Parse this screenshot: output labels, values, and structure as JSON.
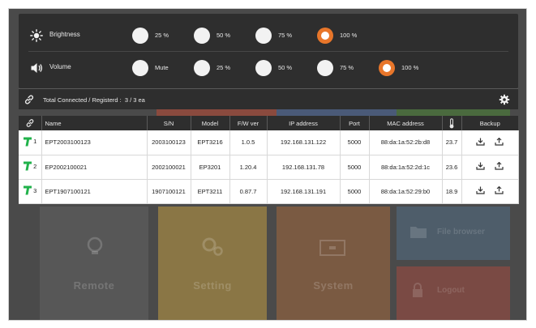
{
  "controls": {
    "brightness": {
      "label": "Brightness",
      "options": [
        "25 %",
        "50 %",
        "75 %",
        "100 %"
      ],
      "selected": "100 %"
    },
    "volume": {
      "label": "Volume",
      "options": [
        "Mute",
        "25 %",
        "50 %",
        "75 %",
        "100 %"
      ],
      "selected": "100 %"
    }
  },
  "status": {
    "connected_label": "Total Connected / Registerd :",
    "connected_value": "3 / 3 ea"
  },
  "table": {
    "headers": {
      "status_icon": "link-icon",
      "name": "Name",
      "sn": "S/N",
      "model": "Model",
      "fw": "F/W ver",
      "ip": "IP address",
      "port": "Port",
      "mac": "MAC address",
      "temp_icon": "thermometer-icon",
      "backup": "Backup"
    },
    "rows": [
      {
        "index": "1",
        "name": "EPT2003100123",
        "sn": "2003100123",
        "model": "EPT3216",
        "fw": "1.0.5",
        "ip": "192.168.131.122",
        "port": "5000",
        "mac": "88:da:1a:52:2b:d8",
        "temp": "23.7"
      },
      {
        "index": "2",
        "name": "EP2002100021",
        "sn": "2002100021",
        "model": "EP3201",
        "fw": "1.20.4",
        "ip": "192.168.131.78",
        "port": "5000",
        "mac": "88:da:1a:52:2d:1c",
        "temp": "23.6"
      },
      {
        "index": "3",
        "name": "EPT1907100121",
        "sn": "1907100121",
        "model": "EPT3211",
        "fw": "0.87.7",
        "ip": "192.168.131.191",
        "port": "5000",
        "mac": "88:da:1a:52:29:b0",
        "temp": "18.9"
      }
    ]
  },
  "background_tiles": {
    "remote": "Remote",
    "setting": "Setting",
    "system": "System",
    "file_browser": "File browser",
    "logout": "Logout"
  },
  "colors": {
    "accent": "#e8762a",
    "device_ok": "#21b24b",
    "panel": "#2e2e2e",
    "backdrop": "#4a4a4a",
    "tile_remote": "#5a5a5a",
    "tile_setting": "#8a7645",
    "tile_system": "#7a5a42",
    "tile_file": "#4e5d6a",
    "tile_logout": "#7a4a44",
    "tile_top_red": "#8a4a3e",
    "tile_top_blue": "#4a5a78",
    "tile_top_green": "#4a6a3e"
  }
}
